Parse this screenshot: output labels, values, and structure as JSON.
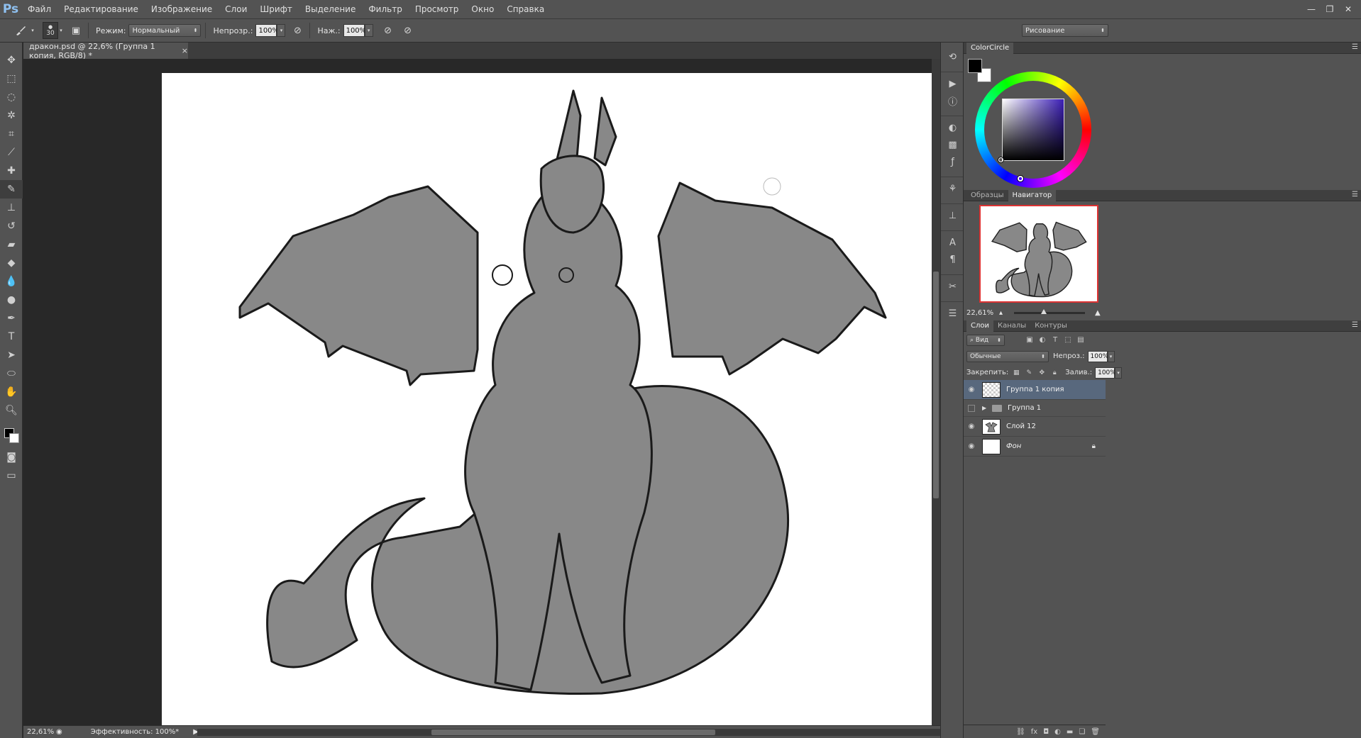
{
  "app": {
    "logo": "Ps"
  },
  "menu": [
    "Файл",
    "Редактирование",
    "Изображение",
    "Слои",
    "Шрифт",
    "Выделение",
    "Фильтр",
    "Просмотр",
    "Окно",
    "Справка"
  ],
  "options": {
    "brush_size": "30",
    "mode_label": "Режим:",
    "mode_value": "Нормальный",
    "opacity_label": "Непрозр.:",
    "opacity_value": "100%",
    "flow_label": "Наж.:",
    "flow_value": "100%",
    "workspace": "Рисование"
  },
  "document": {
    "tab_title": "дракон.psd @ 22,6% (Группа 1 копия, RGB/8) *",
    "close_glyph": "×",
    "canvas_color": "#ffffff"
  },
  "status": {
    "zoom": "22,61%",
    "efficiency": "Эффективность: 100%*"
  },
  "panels": {
    "colorcircle": {
      "title": "ColorCircle",
      "fg_color": "#000000",
      "bg_color": "#ffffff"
    },
    "navigator": {
      "tabs": [
        "Образцы",
        "Навигатор"
      ],
      "active_tab": "Навигатор",
      "zoom": "22,61%"
    },
    "layers": {
      "tabs": [
        "Слои",
        "Каналы",
        "Контуры"
      ],
      "active_tab": "Слои",
      "filter_label": "Вид",
      "blend_mode": "Обычные",
      "opacity_label": "Непроз.:",
      "opacity_value": "100%",
      "lock_label": "Закрепить:",
      "fill_label": "Залив.:",
      "fill_value": "100%",
      "items": [
        {
          "name": "Группа 1 копия",
          "visible": true,
          "selected": true,
          "type": "layer"
        },
        {
          "name": "Группа 1",
          "visible": false,
          "selected": false,
          "type": "group"
        },
        {
          "name": "Слой 12",
          "visible": true,
          "selected": false,
          "type": "layer"
        },
        {
          "name": "Фон",
          "visible": true,
          "selected": false,
          "type": "background",
          "locked": true
        }
      ]
    }
  },
  "icons": {
    "tools": [
      "move-icon",
      "marquee-icon",
      "lasso-icon",
      "magic-wand-icon",
      "crop-icon",
      "eyedropper-icon",
      "healing-icon",
      "brush-icon",
      "stamp-icon",
      "history-brush-icon",
      "eraser-icon",
      "paint-bucket-icon",
      "blur-icon",
      "dodge-icon",
      "pen-icon",
      "type-icon",
      "path-select-icon",
      "ellipse-icon",
      "hand-icon",
      "zoom-icon"
    ]
  }
}
